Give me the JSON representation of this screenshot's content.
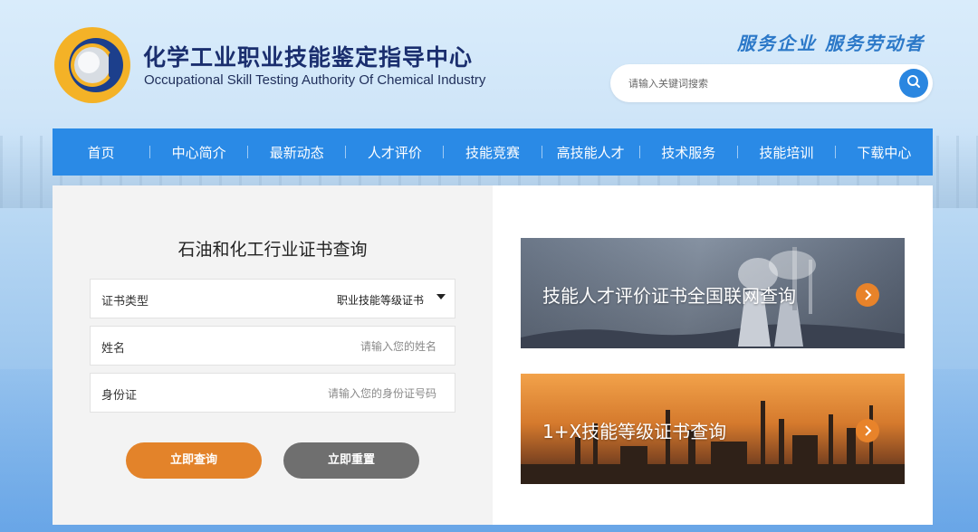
{
  "header": {
    "title": "化学工业职业技能鉴定指导中心",
    "subtitle": "Occupational Skill Testing Authority Of Chemical Industry",
    "slogan": "服务企业 服务劳动者",
    "search": {
      "placeholder": "请输入关键词搜索",
      "icon": "search-icon"
    }
  },
  "nav": {
    "items": [
      {
        "label": "首页"
      },
      {
        "label": "中心简介"
      },
      {
        "label": "最新动态"
      },
      {
        "label": "人才评价"
      },
      {
        "label": "技能竞赛"
      },
      {
        "label": "高技能人才"
      },
      {
        "label": "技术服务"
      },
      {
        "label": "技能培训"
      },
      {
        "label": "下载中心"
      }
    ]
  },
  "form": {
    "title": "石油和化工行业证书查询",
    "cert_type": {
      "label": "证书类型",
      "value": "职业技能等级证书"
    },
    "name": {
      "label": "姓名",
      "placeholder": "请输入您的姓名"
    },
    "id_card": {
      "label": "身份证",
      "placeholder": "请输入您的身份证号码"
    },
    "query_button": "立即查询",
    "reset_button": "立即重置"
  },
  "cards": [
    {
      "label": "技能人才评价证书全国联网查询"
    },
    {
      "label": "1+X技能等级证书查询"
    }
  ],
  "colors": {
    "nav_bg": "#2a8ae6",
    "accent_orange": "#e3832a",
    "reset_gray": "#6f6f6f",
    "title_navy": "#1a2e6e",
    "slogan_blue": "#2b78c8"
  }
}
